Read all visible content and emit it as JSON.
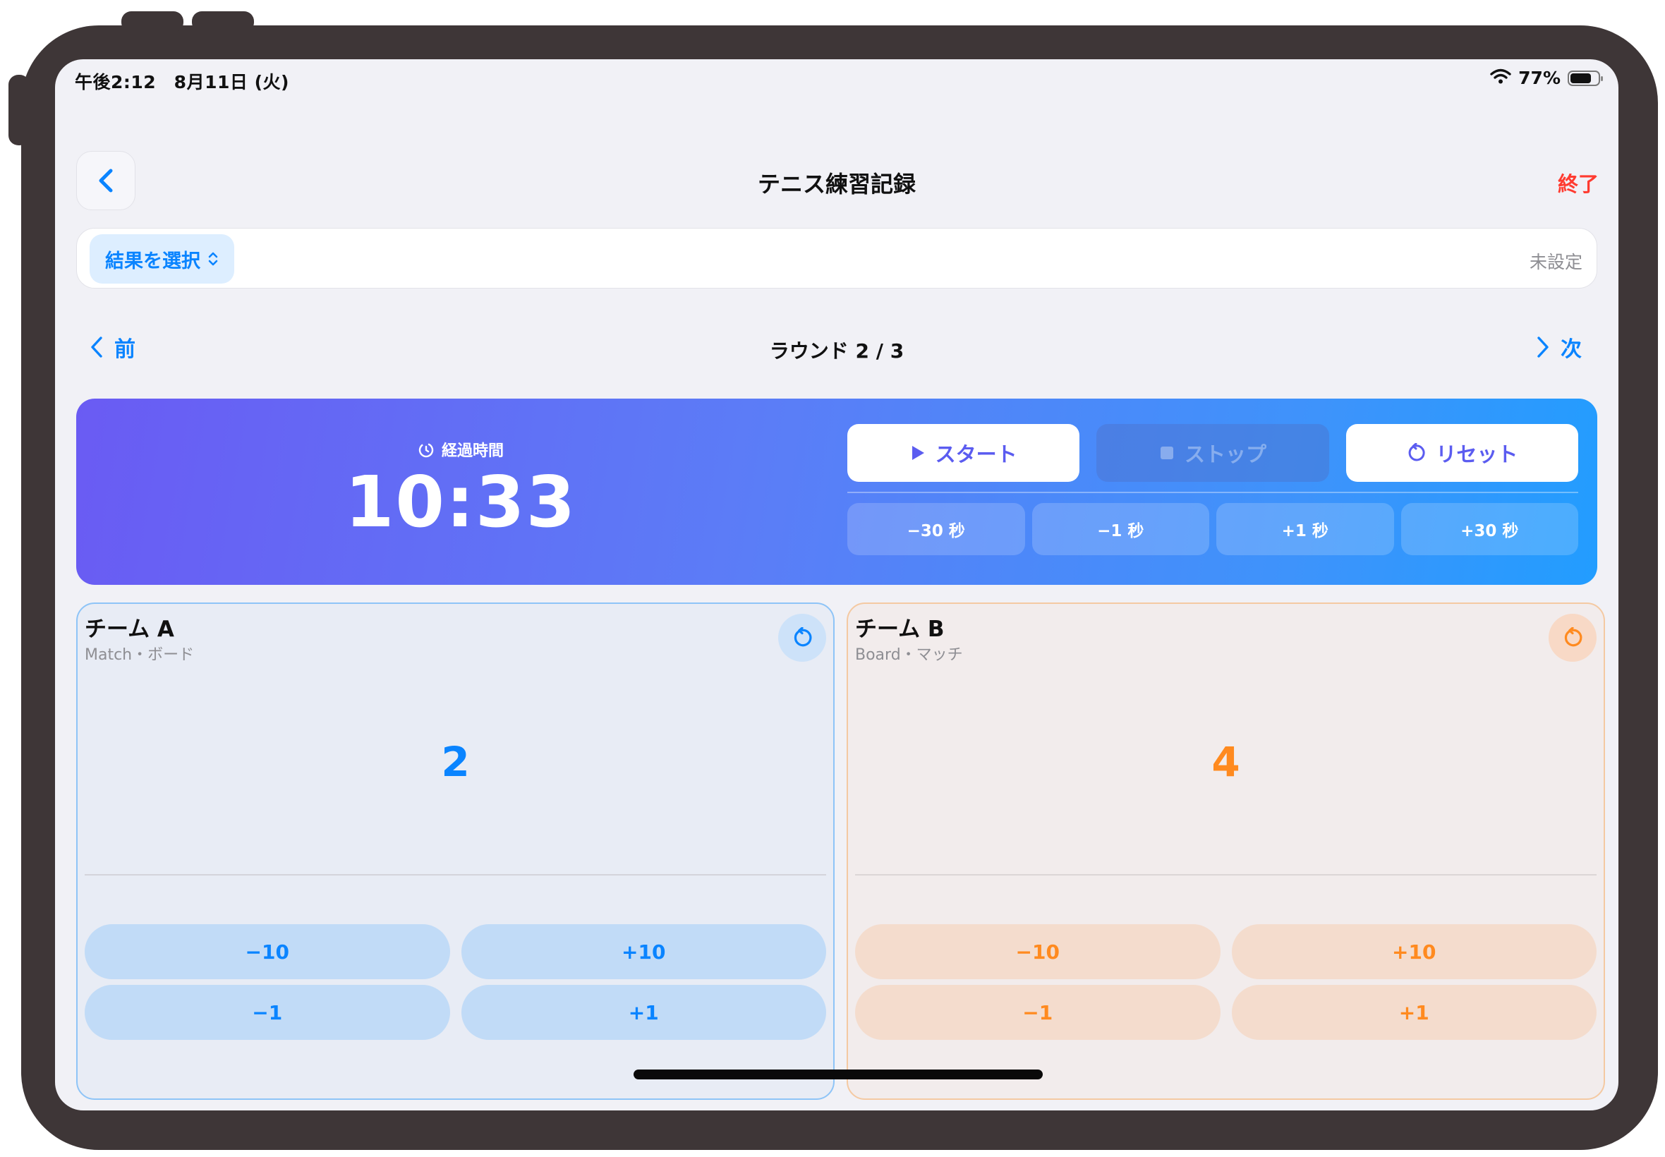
{
  "status": {
    "time": "午後2:12　8月11日 (火)",
    "battery": "77%",
    "battery_level": 0.77
  },
  "nav": {
    "title": "テニス練習記録",
    "end_label": "終了"
  },
  "result": {
    "select_label": "結果を選択",
    "value": "未設定"
  },
  "round": {
    "prev_label": "前",
    "label": "ラウンド 2 / 3",
    "next_label": "次"
  },
  "timer": {
    "caption": "経過時間",
    "value": "10:33",
    "start_label": "スタート",
    "stop_label": "ストップ",
    "reset_label": "リセット",
    "adjust": [
      "−30 秒",
      "−1 秒",
      "+1 秒",
      "+30 秒"
    ]
  },
  "teams": [
    {
      "name": "チーム A",
      "subtitle": "Match・ボード",
      "score": "2",
      "color": "#0a84ff",
      "buttons": [
        "−10",
        "+10",
        "−1",
        "+1"
      ]
    },
    {
      "name": "チーム B",
      "subtitle": "Board・マッチ",
      "score": "4",
      "color": "#ff8a1f",
      "buttons": [
        "−10",
        "+10",
        "−1",
        "+1"
      ]
    }
  ],
  "icons": [
    "chevron-left-icon",
    "chevron-up-down-icon",
    "chevron-right-icon",
    "timer-icon",
    "play-icon",
    "stop-icon",
    "reset-icon",
    "wifi-icon",
    "battery-icon"
  ]
}
